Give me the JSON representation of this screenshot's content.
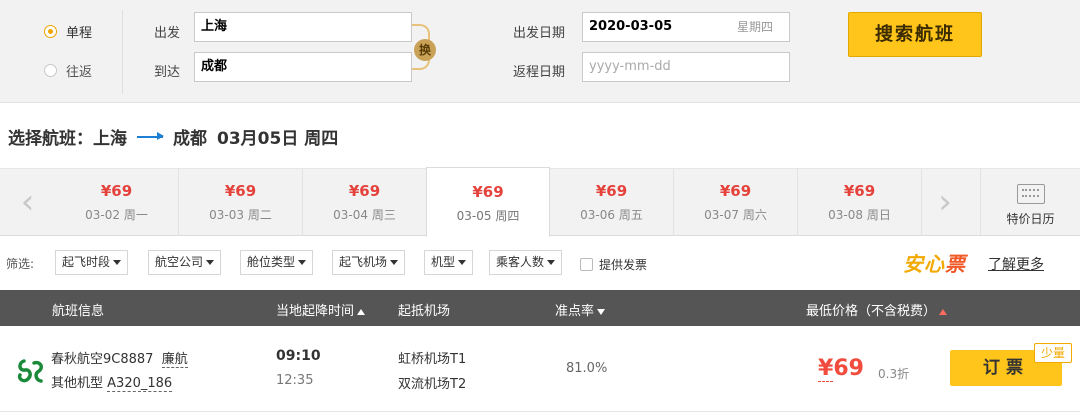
{
  "search": {
    "trip_one_way": "单程",
    "trip_round": "往返",
    "depart_label": "出发",
    "depart_value": "上海",
    "arrive_label": "到达",
    "arrive_value": "成都",
    "swap_label": "换",
    "depart_date_label": "出发日期",
    "depart_date_value": "2020-03-05",
    "depart_weekday": "星期四",
    "return_date_label": "返程日期",
    "return_date_placeholder": "yyyy-mm-dd",
    "search_button": "搜索航班"
  },
  "heading": {
    "prefix": "选择航班：",
    "from": "上海",
    "to": "成都",
    "date": "03月05日 周四"
  },
  "date_strip": [
    {
      "price": "¥69",
      "date": "03-02 周一"
    },
    {
      "price": "¥69",
      "date": "03-03 周二"
    },
    {
      "price": "¥69",
      "date": "03-04 周三"
    },
    {
      "price": "¥69",
      "date": "03-05 周四"
    },
    {
      "price": "¥69",
      "date": "03-06 周五"
    },
    {
      "price": "¥69",
      "date": "03-07 周六"
    },
    {
      "price": "¥69",
      "date": "03-08 周日"
    }
  ],
  "calendar_label": "特价日历",
  "filters": {
    "label": "筛选:",
    "items": [
      "起飞时段",
      "航空公司",
      "舱位类型",
      "起飞机场",
      "机型",
      "乘客人数"
    ],
    "invoice": "提供发票",
    "anxin_a": "安心",
    "anxin_b": "票",
    "learn_more": "了解更多"
  },
  "table_header": {
    "flight_info": "航班信息",
    "times": "当地起降时间",
    "airports": "起抵机场",
    "ontime": "准点率",
    "price": "最低价格（不含税费）"
  },
  "flights": [
    {
      "airline_flight": "春秋航空9C8887",
      "codeshare": "廉航",
      "aircraft_prefix": "其他机型",
      "aircraft": "A320_186",
      "dep_time": "09:10",
      "arr_time": "12:35",
      "dep_airport": "虹桥机场T1",
      "arr_airport": "双流机场T2",
      "ontime": "81.0%",
      "price_symbol": "¥",
      "price": "69",
      "discount": "0.3折",
      "book": "订票",
      "stock": "少量"
    }
  ],
  "colors": {
    "accent": "#ffc51a",
    "price": "#e5423c",
    "header_bg": "#555555"
  }
}
